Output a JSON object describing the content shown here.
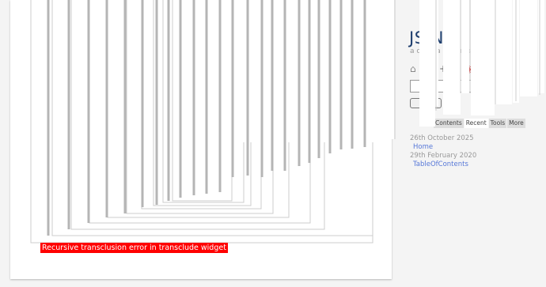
{
  "story": {
    "error_message": "Recursive transclusion error in transclude widget"
  },
  "sidebar": {
    "title": "JS  N  a  le",
    "subtitle": "a  c  d  a  a  o  l  g  n  s  a",
    "controls": {
      "home_icon": "home-icon",
      "new_icon": "plus-icon",
      "fn_label": "I",
      "tag_icon": "circle-icon",
      "check_icon": "check-icon"
    },
    "search_button_label": "",
    "tabs": [
      {
        "label": ""
      },
      {
        "label": "Contents"
      },
      {
        "label": "Recent"
      },
      {
        "label": "Tools"
      },
      {
        "label": "More"
      }
    ],
    "active_tab": "Recent",
    "recent": [
      {
        "date": "26th October 2025",
        "title": "Home"
      },
      {
        "date": "29th February 2020",
        "title": "TableOfContents"
      }
    ]
  },
  "colors": {
    "error_bg": "#ff0000",
    "title_color": "#1e3e6e",
    "link_color": "#5778d8",
    "date_color": "#999999"
  }
}
